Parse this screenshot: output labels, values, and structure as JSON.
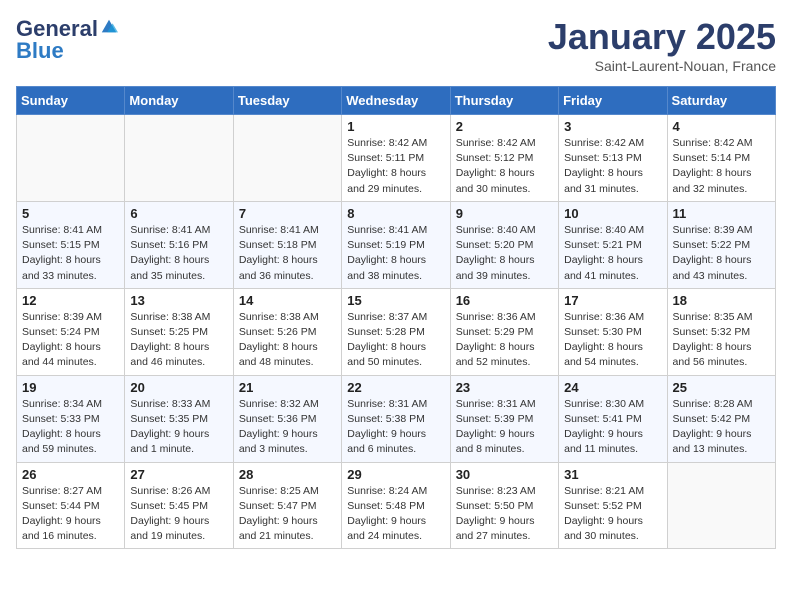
{
  "header": {
    "logo_general": "General",
    "logo_blue": "Blue",
    "month_title": "January 2025",
    "location": "Saint-Laurent-Nouan, France"
  },
  "days_of_week": [
    "Sunday",
    "Monday",
    "Tuesday",
    "Wednesday",
    "Thursday",
    "Friday",
    "Saturday"
  ],
  "weeks": [
    [
      {
        "day": "",
        "info": ""
      },
      {
        "day": "",
        "info": ""
      },
      {
        "day": "",
        "info": ""
      },
      {
        "day": "1",
        "info": "Sunrise: 8:42 AM\nSunset: 5:11 PM\nDaylight: 8 hours\nand 29 minutes."
      },
      {
        "day": "2",
        "info": "Sunrise: 8:42 AM\nSunset: 5:12 PM\nDaylight: 8 hours\nand 30 minutes."
      },
      {
        "day": "3",
        "info": "Sunrise: 8:42 AM\nSunset: 5:13 PM\nDaylight: 8 hours\nand 31 minutes."
      },
      {
        "day": "4",
        "info": "Sunrise: 8:42 AM\nSunset: 5:14 PM\nDaylight: 8 hours\nand 32 minutes."
      }
    ],
    [
      {
        "day": "5",
        "info": "Sunrise: 8:41 AM\nSunset: 5:15 PM\nDaylight: 8 hours\nand 33 minutes."
      },
      {
        "day": "6",
        "info": "Sunrise: 8:41 AM\nSunset: 5:16 PM\nDaylight: 8 hours\nand 35 minutes."
      },
      {
        "day": "7",
        "info": "Sunrise: 8:41 AM\nSunset: 5:18 PM\nDaylight: 8 hours\nand 36 minutes."
      },
      {
        "day": "8",
        "info": "Sunrise: 8:41 AM\nSunset: 5:19 PM\nDaylight: 8 hours\nand 38 minutes."
      },
      {
        "day": "9",
        "info": "Sunrise: 8:40 AM\nSunset: 5:20 PM\nDaylight: 8 hours\nand 39 minutes."
      },
      {
        "day": "10",
        "info": "Sunrise: 8:40 AM\nSunset: 5:21 PM\nDaylight: 8 hours\nand 41 minutes."
      },
      {
        "day": "11",
        "info": "Sunrise: 8:39 AM\nSunset: 5:22 PM\nDaylight: 8 hours\nand 43 minutes."
      }
    ],
    [
      {
        "day": "12",
        "info": "Sunrise: 8:39 AM\nSunset: 5:24 PM\nDaylight: 8 hours\nand 44 minutes."
      },
      {
        "day": "13",
        "info": "Sunrise: 8:38 AM\nSunset: 5:25 PM\nDaylight: 8 hours\nand 46 minutes."
      },
      {
        "day": "14",
        "info": "Sunrise: 8:38 AM\nSunset: 5:26 PM\nDaylight: 8 hours\nand 48 minutes."
      },
      {
        "day": "15",
        "info": "Sunrise: 8:37 AM\nSunset: 5:28 PM\nDaylight: 8 hours\nand 50 minutes."
      },
      {
        "day": "16",
        "info": "Sunrise: 8:36 AM\nSunset: 5:29 PM\nDaylight: 8 hours\nand 52 minutes."
      },
      {
        "day": "17",
        "info": "Sunrise: 8:36 AM\nSunset: 5:30 PM\nDaylight: 8 hours\nand 54 minutes."
      },
      {
        "day": "18",
        "info": "Sunrise: 8:35 AM\nSunset: 5:32 PM\nDaylight: 8 hours\nand 56 minutes."
      }
    ],
    [
      {
        "day": "19",
        "info": "Sunrise: 8:34 AM\nSunset: 5:33 PM\nDaylight: 8 hours\nand 59 minutes."
      },
      {
        "day": "20",
        "info": "Sunrise: 8:33 AM\nSunset: 5:35 PM\nDaylight: 9 hours\nand 1 minute."
      },
      {
        "day": "21",
        "info": "Sunrise: 8:32 AM\nSunset: 5:36 PM\nDaylight: 9 hours\nand 3 minutes."
      },
      {
        "day": "22",
        "info": "Sunrise: 8:31 AM\nSunset: 5:38 PM\nDaylight: 9 hours\nand 6 minutes."
      },
      {
        "day": "23",
        "info": "Sunrise: 8:31 AM\nSunset: 5:39 PM\nDaylight: 9 hours\nand 8 minutes."
      },
      {
        "day": "24",
        "info": "Sunrise: 8:30 AM\nSunset: 5:41 PM\nDaylight: 9 hours\nand 11 minutes."
      },
      {
        "day": "25",
        "info": "Sunrise: 8:28 AM\nSunset: 5:42 PM\nDaylight: 9 hours\nand 13 minutes."
      }
    ],
    [
      {
        "day": "26",
        "info": "Sunrise: 8:27 AM\nSunset: 5:44 PM\nDaylight: 9 hours\nand 16 minutes."
      },
      {
        "day": "27",
        "info": "Sunrise: 8:26 AM\nSunset: 5:45 PM\nDaylight: 9 hours\nand 19 minutes."
      },
      {
        "day": "28",
        "info": "Sunrise: 8:25 AM\nSunset: 5:47 PM\nDaylight: 9 hours\nand 21 minutes."
      },
      {
        "day": "29",
        "info": "Sunrise: 8:24 AM\nSunset: 5:48 PM\nDaylight: 9 hours\nand 24 minutes."
      },
      {
        "day": "30",
        "info": "Sunrise: 8:23 AM\nSunset: 5:50 PM\nDaylight: 9 hours\nand 27 minutes."
      },
      {
        "day": "31",
        "info": "Sunrise: 8:21 AM\nSunset: 5:52 PM\nDaylight: 9 hours\nand 30 minutes."
      },
      {
        "day": "",
        "info": ""
      }
    ]
  ]
}
